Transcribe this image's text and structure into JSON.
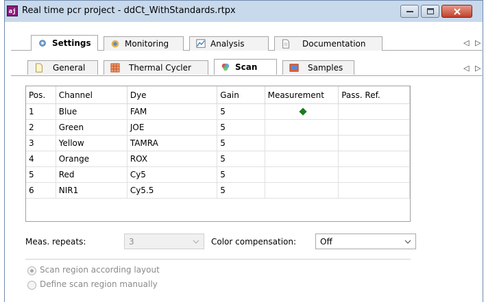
{
  "window": {
    "app_icon_text": "aj",
    "title": "Real time pcr project - ddCt_WithStandards.rtpx"
  },
  "main_tabs": [
    {
      "label": "Settings",
      "icon": "gear-icon",
      "active": true
    },
    {
      "label": "Monitoring",
      "icon": "monitor-icon",
      "active": false
    },
    {
      "label": "Analysis",
      "icon": "chart-icon",
      "active": false
    },
    {
      "label": "Documentation",
      "icon": "document-icon",
      "active": false
    }
  ],
  "sub_tabs": [
    {
      "label": "General",
      "icon": "page-icon",
      "active": false
    },
    {
      "label": "Thermal Cycler",
      "icon": "grid-icon",
      "active": false
    },
    {
      "label": "Scan",
      "icon": "scan-icon",
      "active": true
    },
    {
      "label": "Samples",
      "icon": "samples-icon",
      "active": false
    }
  ],
  "scroll_arrows": {
    "left": "◁",
    "right": "▷"
  },
  "table": {
    "columns": [
      "Pos.",
      "Channel",
      "Dye",
      "Gain",
      "Measurement",
      "Pass. Ref."
    ],
    "rows": [
      {
        "pos": "1",
        "channel": "Blue",
        "dye": "FAM",
        "gain": "5",
        "measurement": true,
        "pass_ref": ""
      },
      {
        "pos": "2",
        "channel": "Green",
        "dye": "JOE",
        "gain": "5",
        "measurement": false,
        "pass_ref": ""
      },
      {
        "pos": "3",
        "channel": "Yellow",
        "dye": "TAMRA",
        "gain": "5",
        "measurement": false,
        "pass_ref": ""
      },
      {
        "pos": "4",
        "channel": "Orange",
        "dye": "ROX",
        "gain": "5",
        "measurement": false,
        "pass_ref": ""
      },
      {
        "pos": "5",
        "channel": "Red",
        "dye": "Cy5",
        "gain": "5",
        "measurement": false,
        "pass_ref": ""
      },
      {
        "pos": "6",
        "channel": "NIR1",
        "dye": "Cy5.5",
        "gain": "5",
        "measurement": false,
        "pass_ref": ""
      }
    ],
    "measurement_marker_color": "#1f7a1f"
  },
  "controls": {
    "meas_repeats_label": "Meas. repeats:",
    "meas_repeats_value": "3",
    "color_comp_label": "Color compensation:",
    "color_comp_value": "Off",
    "radio_scan_layout": "Scan region according layout",
    "radio_manual": "Define scan region manually"
  }
}
